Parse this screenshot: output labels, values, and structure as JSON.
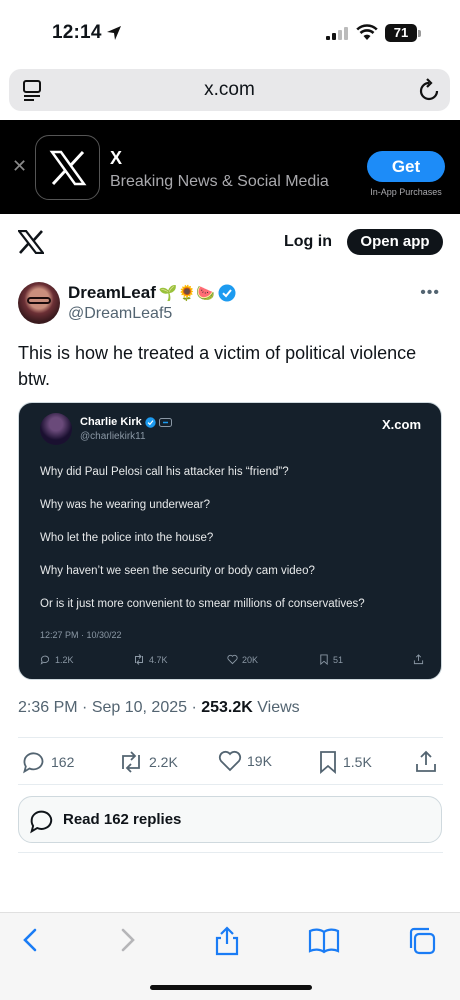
{
  "status_bar": {
    "time": "12:14",
    "battery": "71"
  },
  "browser": {
    "url": "x.com"
  },
  "app_banner": {
    "app_name": "X",
    "subtitle": "Breaking News & Social Media",
    "get_label": "Get",
    "in_app_purchases": "In-App Purchases"
  },
  "x_header": {
    "login_label": "Log in",
    "open_app_label": "Open app"
  },
  "tweet": {
    "display_name": "DreamLeaf",
    "emojis": "🌱🌻🍉",
    "handle": "@DreamLeaf5",
    "text": "This is how he treated a victim of political violence btw.",
    "time": "2:36 PM",
    "date": "Sep 10, 2025",
    "views_count": "253.2K",
    "views_label": "Views",
    "replies": "162",
    "reposts": "2.2K",
    "likes": "19K",
    "bookmarks": "1.5K",
    "read_replies_label": "Read 162 replies"
  },
  "quoted": {
    "name": "Charlie Kirk",
    "handle": "@charliekirk11",
    "brand": "X.com",
    "lines": [
      "Why did Paul Pelosi call his attacker his “friend”?",
      "Why was he wearing underwear?",
      "Who let the police into the house?",
      "Why haven’t we seen the security or body cam video?",
      "Or is it just more convenient to smear millions of conservatives?"
    ],
    "timestamp": "12:27 PM · 10/30/22",
    "replies": "1.2K",
    "reposts": "4.7K",
    "likes": "20K",
    "bookmarks": "51"
  },
  "colors": {
    "verified": "#1d9bf0",
    "banner_bg": "#000000",
    "get_button": "#1d8cf8",
    "card_bg": "#15202b",
    "ios_blue": "#1a7cf5"
  }
}
